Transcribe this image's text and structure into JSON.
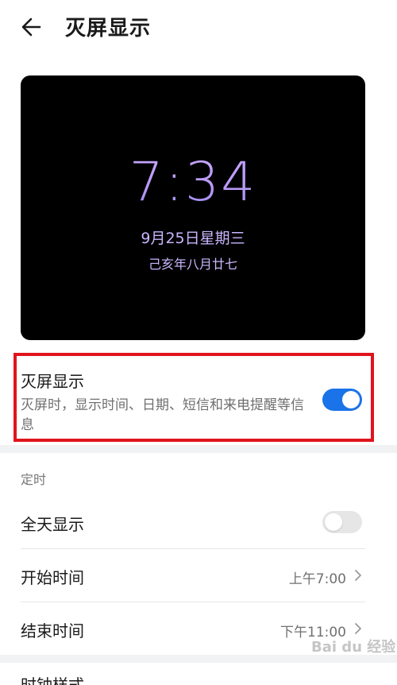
{
  "header": {
    "title": "灭屏显示"
  },
  "preview": {
    "time": "7:34",
    "date": "9月25日星期三",
    "lunar": "己亥年八月廿七"
  },
  "aod": {
    "title": "灭屏显示",
    "description": "灭屏时，显示时间、日期、短信和来电提醒等信息",
    "enabled": true
  },
  "schedule": {
    "section_label": "定时",
    "all_day": {
      "label": "全天显示",
      "enabled": false
    },
    "start": {
      "label": "开始时间",
      "value": "上午7:00"
    },
    "end": {
      "label": "结束时间",
      "value": "下午11:00"
    }
  },
  "next_row": {
    "label": "时钟样式"
  },
  "watermark": "Bai du 经验",
  "colors": {
    "accent": "#1a73e8",
    "highlight": "#e0141c",
    "clock": "#b999f6"
  }
}
